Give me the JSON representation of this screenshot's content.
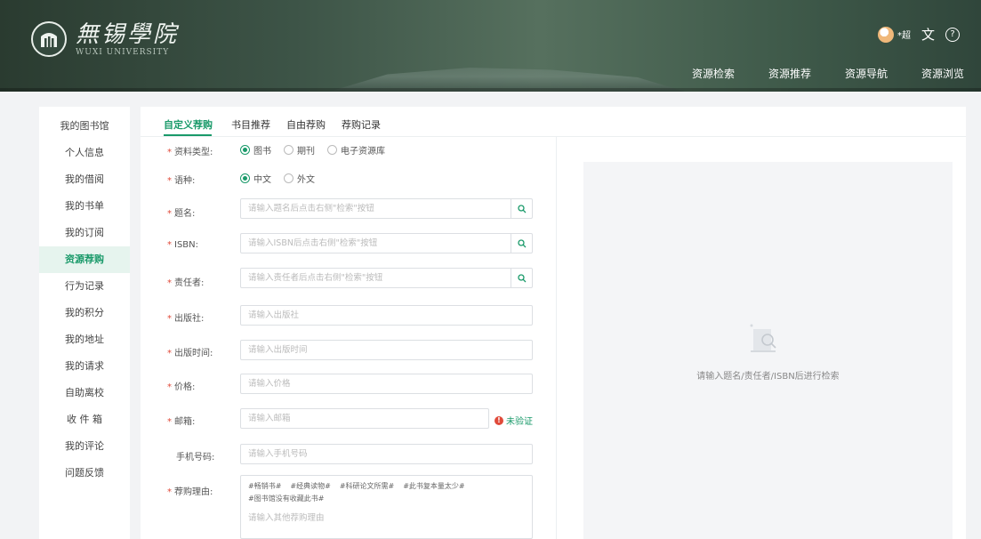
{
  "header": {
    "logo_cn": "無锡學院",
    "logo_en": "WUXI UNIVERSITY",
    "user_name": "*超",
    "nav": [
      "资源检索",
      "资源推荐",
      "资源导航",
      "资源浏览"
    ]
  },
  "sidebar": {
    "items": [
      {
        "label": "我的图书馆"
      },
      {
        "label": "个人信息"
      },
      {
        "label": "我的借阅"
      },
      {
        "label": "我的书单"
      },
      {
        "label": "我的订阅"
      },
      {
        "label": "资源荐购"
      },
      {
        "label": "行为记录"
      },
      {
        "label": "我的积分"
      },
      {
        "label": "我的地址"
      },
      {
        "label": "我的请求"
      },
      {
        "label": "自助离校"
      },
      {
        "label": "收 件 箱"
      },
      {
        "label": "我的评论"
      },
      {
        "label": "问题反馈"
      }
    ],
    "active_index": 5
  },
  "tabs": [
    "自定义荐购",
    "书目推荐",
    "自由荐购",
    "荐购记录"
  ],
  "form": {
    "resource_type": {
      "label": "资料类型:",
      "options": [
        "图书",
        "期刊",
        "电子资源库"
      ],
      "selected": "图书"
    },
    "language": {
      "label": "语种:",
      "options": [
        "中文",
        "外文"
      ],
      "selected": "中文"
    },
    "title": {
      "label": "题名:",
      "placeholder": "请输入题名后点击右侧\"检索\"按钮"
    },
    "isbn": {
      "label": "ISBN:",
      "placeholder": "请输入ISBN后点击右侧\"检索\"按钮"
    },
    "author": {
      "label": "责任者:",
      "placeholder": "请输入责任者后点击右侧\"检索\"按钮"
    },
    "publisher": {
      "label": "出版社:",
      "placeholder": "请输入出版社"
    },
    "pub_date": {
      "label": "出版时间:",
      "placeholder": "请输入出版时间"
    },
    "price": {
      "label": "价格:",
      "placeholder": "请输入价格"
    },
    "email": {
      "label": "邮箱:",
      "placeholder": "请输入邮箱",
      "status": "未验证"
    },
    "phone": {
      "label": "手机号码:",
      "placeholder": "请输入手机号码"
    },
    "reason": {
      "label": "荐购理由:",
      "tags": [
        "#畅销书#",
        "#经典读物#",
        "#科研论文所需#",
        "#此书复本量太少#",
        "#图书馆没有收藏此书#"
      ],
      "placeholder": "请输入其他荐购理由"
    }
  },
  "preview": {
    "empty_text": "请输入题名/责任者/ISBN后进行检索"
  },
  "colors": {
    "accent": "#1a9a6a",
    "required": "#e04a3a"
  }
}
